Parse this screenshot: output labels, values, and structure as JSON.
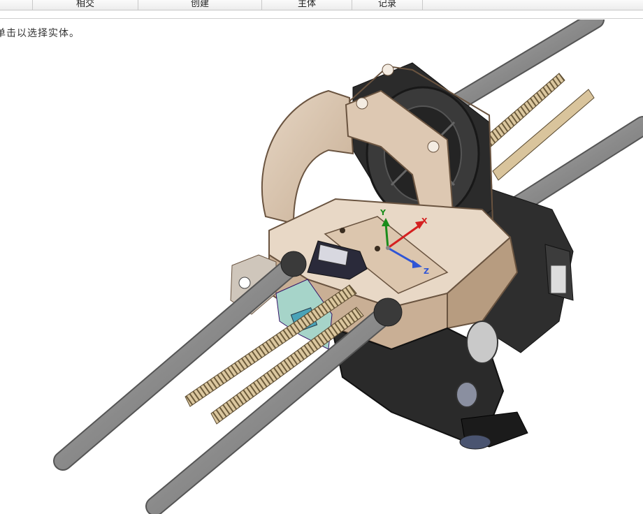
{
  "toolbar": {
    "tabs": [
      "相交",
      "创建",
      "主体",
      "记录"
    ]
  },
  "hint": "单击以选择实体。",
  "triad": {
    "y": "Y",
    "x": "X",
    "z": "Z"
  },
  "colors": {
    "housing": "#d8c3ad",
    "rod": "#8e8e8e",
    "fan": "#2b2b2b",
    "motor": "#2e2e2e",
    "rack": "#d9c49c",
    "axis_y": "#1a8c1a",
    "axis_x": "#d42020",
    "axis_z": "#2f55d6"
  },
  "icons": [
    "view-triad-icon"
  ]
}
